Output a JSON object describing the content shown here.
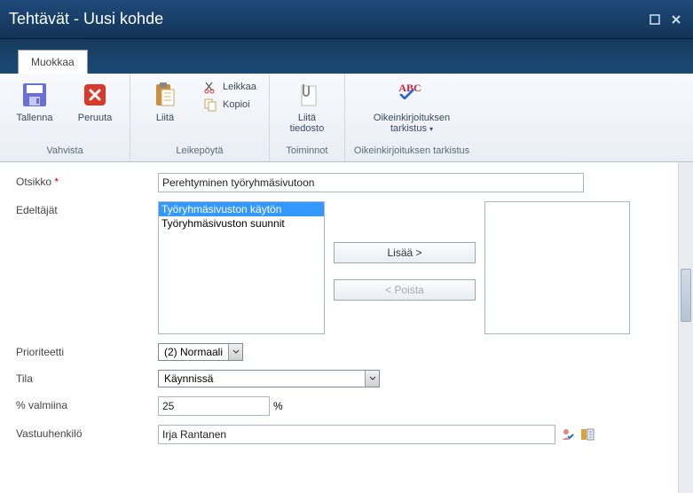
{
  "titlebar": {
    "title": "Tehtävät - Uusi kohde"
  },
  "tab": {
    "edit": "Muokkaa"
  },
  "ribbon": {
    "save": "Tallenna",
    "cancel": "Peruuta",
    "group_confirm": "Vahvista",
    "paste": "Liitä",
    "cut": "Leikkaa",
    "copy": "Kopioi",
    "group_clipboard": "Leikepöytä",
    "attach": "Liitä tiedosto",
    "group_actions": "Toiminnot",
    "spelling": "Oikeinkirjoituksen tarkistus",
    "group_spelling": "Oikeinkirjoituksen tarkistus"
  },
  "form": {
    "title_label": "Otsikko",
    "title_value": "Perehtyminen työryhmäsivutoon",
    "predecessors_label": "Edeltäjät",
    "pred_options": [
      "Työryhmäsivuston käytön",
      "Työryhmäsivuston suunnit"
    ],
    "add_btn": "Lisää >",
    "remove_btn": "< Poista",
    "priority_label": "Prioriteetti",
    "priority_value": "(2) Normaali",
    "status_label": "Tila",
    "status_value": "Käynnissä",
    "percent_label": "% valmiina",
    "percent_value": "25",
    "percent_suffix": "%",
    "assignee_label": "Vastuuhenkilö",
    "assignee_value": "Irja Rantanen"
  }
}
